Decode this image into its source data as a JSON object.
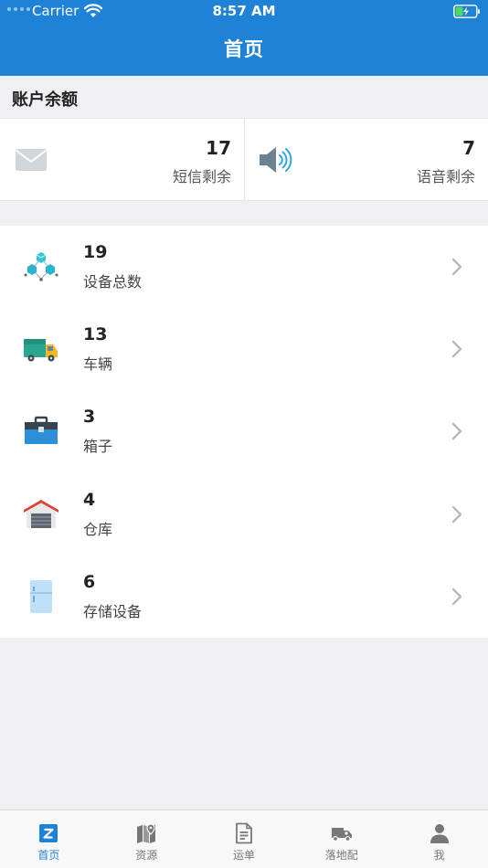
{
  "status_bar": {
    "carrier": "Carrier",
    "time": "8:57 AM"
  },
  "header": {
    "title": "首页"
  },
  "balance": {
    "section_title": "账户余额",
    "sms": {
      "value": "17",
      "label": "短信剩余"
    },
    "voice": {
      "value": "7",
      "label": "语音剩余"
    }
  },
  "resources": [
    {
      "count": "19",
      "label": "设备总数",
      "icon": "cubes-icon"
    },
    {
      "count": "13",
      "label": "车辆",
      "icon": "truck-icon"
    },
    {
      "count": "3",
      "label": "箱子",
      "icon": "toolbox-icon"
    },
    {
      "count": "4",
      "label": "仓库",
      "icon": "warehouse-icon"
    },
    {
      "count": "6",
      "label": "存储设备",
      "icon": "fridge-icon"
    }
  ],
  "tabs": [
    {
      "label": "首页",
      "icon": "home-z-icon",
      "active": true
    },
    {
      "label": "资源",
      "icon": "map-pin-icon",
      "active": false
    },
    {
      "label": "运单",
      "icon": "document-icon",
      "active": false
    },
    {
      "label": "落地配",
      "icon": "delivery-truck-icon",
      "active": false
    },
    {
      "label": "我",
      "icon": "user-icon",
      "active": false
    }
  ],
  "colors": {
    "primary": "#1e82d6",
    "background": "#f0f0f4",
    "tab_inactive": "#777777"
  }
}
